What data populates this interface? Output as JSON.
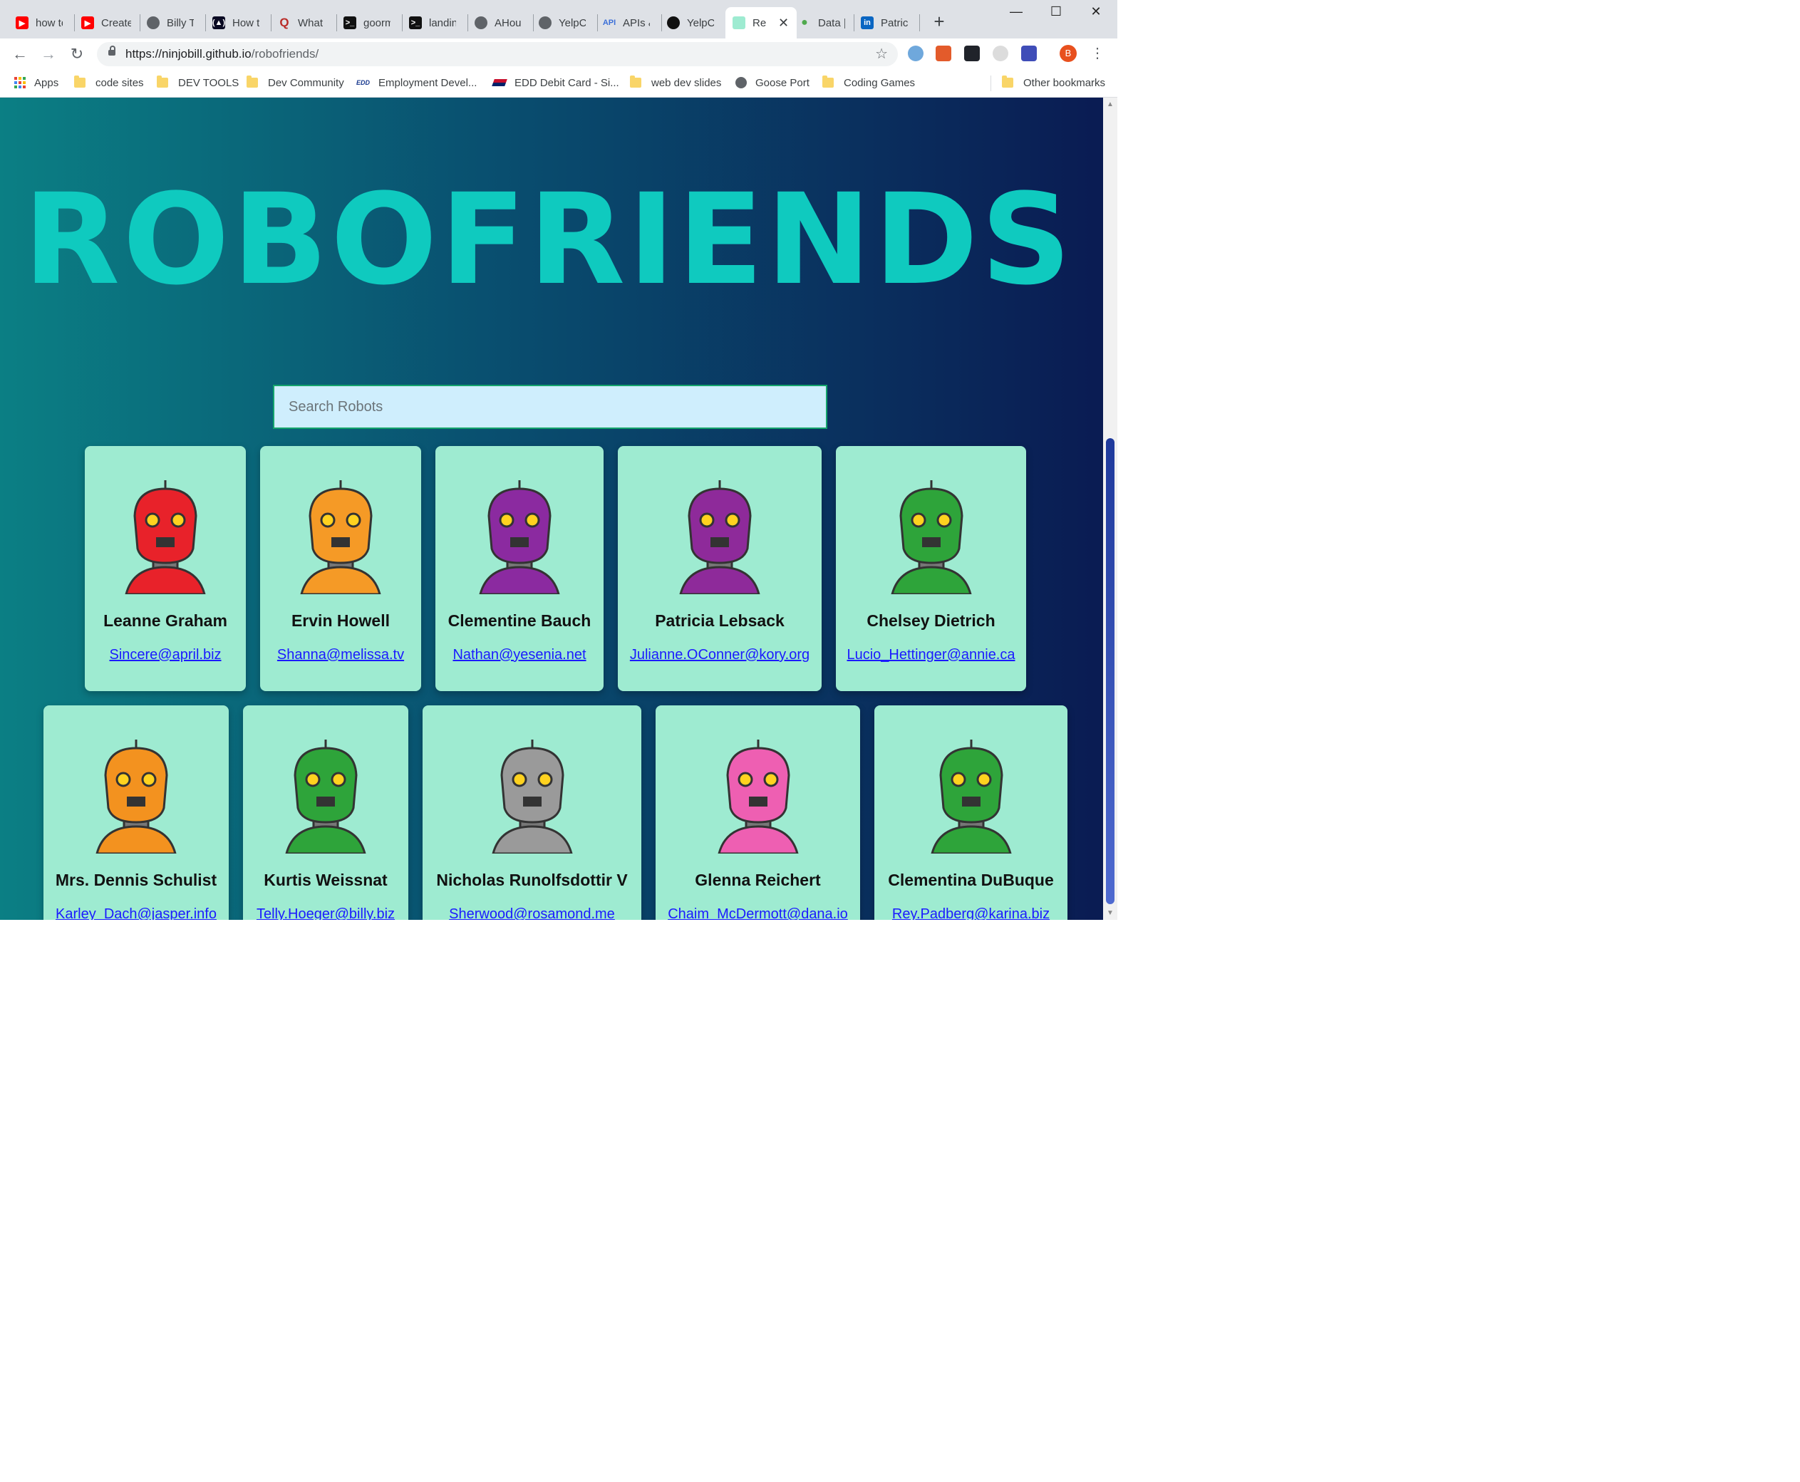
{
  "browser": {
    "tabs": [
      {
        "title": "how to",
        "icon": "youtube-icon"
      },
      {
        "title": "Create",
        "icon": "youtube-icon"
      },
      {
        "title": "Billy Tc",
        "icon": "globe-icon"
      },
      {
        "title": "How to",
        "icon": "freecodecamp-icon"
      },
      {
        "title": "What a",
        "icon": "quora-icon"
      },
      {
        "title": "goorm",
        "icon": "terminal-icon"
      },
      {
        "title": "landin",
        "icon": "terminal-icon"
      },
      {
        "title": "AHous",
        "icon": "globe-icon"
      },
      {
        "title": "YelpCa",
        "icon": "globe-icon"
      },
      {
        "title": "APIs &",
        "icon": "api-icon"
      },
      {
        "title": "YelpCa",
        "icon": "github-icon"
      },
      {
        "title": "Re",
        "icon": "robofriends-icon",
        "active": true
      },
      {
        "title": "Data |",
        "icon": "mongodb-icon"
      },
      {
        "title": "Patrick",
        "icon": "linkedin-icon"
      }
    ],
    "url_host": "https://ninjobill.github.io",
    "url_path": "/robofriends/",
    "profile_initial": "B",
    "bookmarks": [
      {
        "label": "Apps",
        "icon": "apps-icon"
      },
      {
        "label": "code sites",
        "icon": "folder-icon"
      },
      {
        "label": "DEV TOOLS",
        "icon": "folder-icon"
      },
      {
        "label": "Dev Community",
        "icon": "folder-icon"
      },
      {
        "label": "Employment Devel...",
        "icon": "edd-icon"
      },
      {
        "label": "EDD Debit Card - Si...",
        "icon": "bofa-icon"
      },
      {
        "label": "web dev slides",
        "icon": "folder-icon"
      },
      {
        "label": "Goose Port",
        "icon": "globe-icon"
      },
      {
        "label": "Coding Games",
        "icon": "folder-icon"
      },
      {
        "label": "Other bookmarks",
        "icon": "folder-icon"
      }
    ]
  },
  "page": {
    "logo": "ROBOFRIENDS",
    "search_placeholder": "Search Robots",
    "robots": [
      {
        "name": "Leanne Graham",
        "email": "Sincere@april.biz",
        "color": "#e8222a"
      },
      {
        "name": "Ervin Howell",
        "email": "Shanna@melissa.tv",
        "color": "#f59a26"
      },
      {
        "name": "Clementine Bauch",
        "email": "Nathan@yesenia.net",
        "color": "#8b2aa0"
      },
      {
        "name": "Patricia Lebsack",
        "email": "Julianne.OConner@kory.org",
        "color": "#8e2a9a"
      },
      {
        "name": "Chelsey Dietrich",
        "email": "Lucio_Hettinger@annie.ca",
        "color": "#2ea43a"
      },
      {
        "name": "Mrs. Dennis Schulist",
        "email": "Karley_Dach@jasper.info",
        "color": "#f3921f"
      },
      {
        "name": "Kurtis Weissnat",
        "email": "Telly.Hoeger@billy.biz",
        "color": "#2ea43a"
      },
      {
        "name": "Nicholas Runolfsdottir V",
        "email": "Sherwood@rosamond.me",
        "color": "#9a9a9a"
      },
      {
        "name": "Glenna Reichert",
        "email": "Chaim_McDermott@dana.io",
        "color": "#ee5fb2"
      },
      {
        "name": "Clementina DuBuque",
        "email": "Rey.Padberg@karina.biz",
        "color": "#2ea43a"
      }
    ]
  }
}
